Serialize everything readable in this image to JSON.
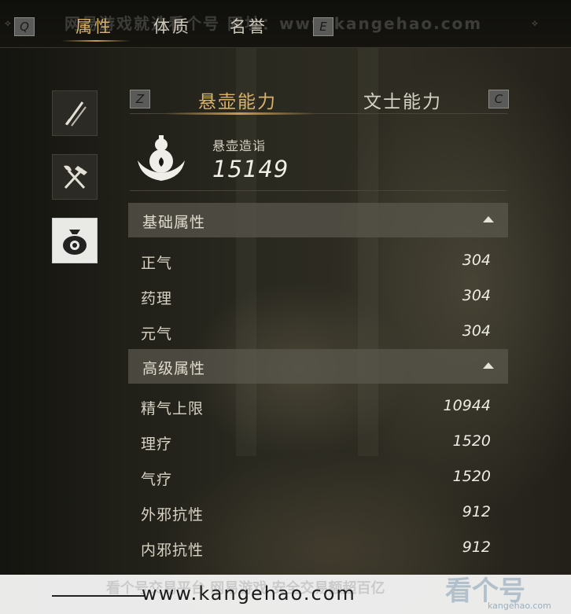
{
  "top_tabs": {
    "prev_key": "Q",
    "next_key": "E",
    "items": [
      {
        "label": "属性",
        "active": true
      },
      {
        "label": "体质",
        "active": false
      },
      {
        "label": "名誉",
        "active": false
      }
    ]
  },
  "top_watermark": "网易游戏就选看个号 网址：www.kangehao.com",
  "side_icons": [
    "weapons-icon",
    "shovel-pickaxe-icon",
    "money-bag-icon"
  ],
  "sub_tabs": {
    "prev_key": "Z",
    "next_key": "C",
    "items": [
      {
        "label": "悬壶能力",
        "active": true
      },
      {
        "label": "文士能力",
        "active": false
      }
    ]
  },
  "profession": {
    "icon": "gourd-icon",
    "label": "悬壶造诣",
    "value": "15149"
  },
  "basic_section": {
    "title": "基础属性",
    "rows": [
      {
        "label": "正气",
        "value": "304"
      },
      {
        "label": "药理",
        "value": "304"
      },
      {
        "label": "元气",
        "value": "304"
      }
    ]
  },
  "advanced_section": {
    "title": "高级属性",
    "rows": [
      {
        "label": "精气上限",
        "value": "10944"
      },
      {
        "label": "理疗",
        "value": "1520"
      },
      {
        "label": "气疗",
        "value": "1520"
      },
      {
        "label": "外邪抗性",
        "value": "912"
      },
      {
        "label": "内邪抗性",
        "value": "912"
      }
    ]
  },
  "bottom_banner": {
    "url": "www.kangehao.com",
    "ghost_text": "看个号交易平台 网易游戏 安全交易额超百亿",
    "logo": "看个号",
    "logo_sub": "kangehao.com"
  },
  "colors": {
    "accent_gold": "#d9b26a",
    "section_bg": "#5a584e",
    "active_side_bg": "#e9e9e6"
  }
}
